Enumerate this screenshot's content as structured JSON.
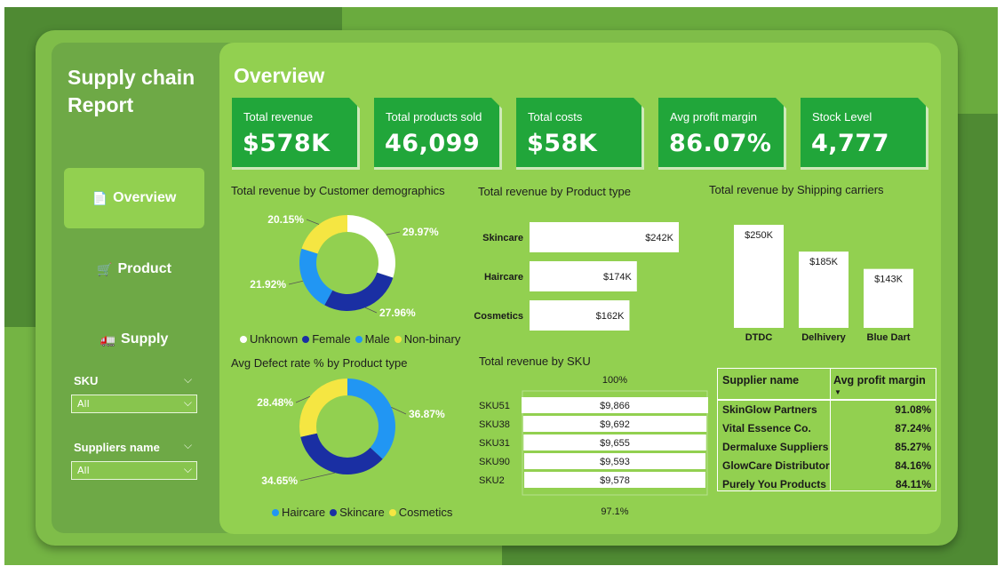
{
  "sidebar": {
    "title_line1": "Supply chain",
    "title_line2": "Report",
    "nav": [
      {
        "label": "Overview",
        "icon": "📄",
        "icon_name": "document-icon",
        "active": true
      },
      {
        "label": "Product",
        "icon": "🛒",
        "icon_name": "cart-icon",
        "active": false
      },
      {
        "label": "Supply",
        "icon": "🚛",
        "icon_name": "truck-icon",
        "active": false
      }
    ],
    "filters": [
      {
        "label": "SKU",
        "value": "All"
      },
      {
        "label": "Suppliers name",
        "value": "All"
      }
    ]
  },
  "main": {
    "title": "Overview"
  },
  "kpis": [
    {
      "label": "Total revenue",
      "value": "$578K"
    },
    {
      "label": "Total products sold",
      "value": "46,099"
    },
    {
      "label": "Total costs",
      "value": "$58K"
    },
    {
      "label": "Avg profit margin",
      "value": "86.07%"
    },
    {
      "label": "Stock Level",
      "value": "4,777"
    }
  ],
  "colors": {
    "white": "#ffffff",
    "navy": "#1a2fa3",
    "blue": "#2196f3",
    "yellow": "#f5e642",
    "kpi_green": "#21a63a",
    "panel_green": "#92d050"
  },
  "chart_data": [
    {
      "type": "pie",
      "title": "Total revenue by Customer demographics",
      "categories": [
        "Unknown",
        "Female",
        "Male",
        "Non-binary"
      ],
      "values": [
        29.97,
        27.96,
        21.92,
        20.15
      ],
      "value_labels": [
        "29.97%",
        "27.96%",
        "21.92%",
        "20.15%"
      ],
      "colors": [
        "#ffffff",
        "#1a2fa3",
        "#2196f3",
        "#f5e642"
      ],
      "legend": "bottom"
    },
    {
      "type": "pie",
      "title": "Avg Defect rate % by Product type",
      "categories": [
        "Haircare",
        "Skincare",
        "Cosmetics"
      ],
      "values": [
        36.87,
        34.65,
        28.48
      ],
      "value_labels": [
        "36.87%",
        "34.65%",
        "28.48%"
      ],
      "colors": [
        "#2196f3",
        "#1a2fa3",
        "#f5e642"
      ],
      "legend": "bottom"
    },
    {
      "type": "bar",
      "orientation": "horizontal",
      "title": "Total revenue by Product type",
      "categories": [
        "Skincare",
        "Haircare",
        "Cosmetics"
      ],
      "values": [
        242,
        174,
        162
      ],
      "value_labels": [
        "$242K",
        "$174K",
        "$162K"
      ],
      "unit": "K$"
    },
    {
      "type": "bar",
      "orientation": "vertical",
      "title": "Total revenue by Shipping carriers",
      "categories": [
        "DTDC",
        "Delhivery",
        "Blue Dart"
      ],
      "values": [
        250,
        185,
        143
      ],
      "value_labels": [
        "$250K",
        "$185K",
        "$143K"
      ],
      "unit": "K$"
    },
    {
      "type": "bar",
      "orientation": "funnel",
      "title": "Total revenue by SKU",
      "categories": [
        "SKU51",
        "SKU38",
        "SKU31",
        "SKU90",
        "SKU2"
      ],
      "values": [
        9866,
        9692,
        9655,
        9593,
        9578
      ],
      "value_labels": [
        "$9,866",
        "$9,692",
        "$9,655",
        "$9,593",
        "$9,578"
      ],
      "top_label": "100%",
      "bottom_label": "97.1%"
    }
  ],
  "supplier_table": {
    "headers": [
      "Supplier name",
      "Avg profit margin"
    ],
    "rows": [
      [
        "SkinGlow Partners",
        "91.08%"
      ],
      [
        "Vital Essence Co.",
        "87.24%"
      ],
      [
        "Dermaluxe Suppliers",
        "85.27%"
      ],
      [
        "GlowCare Distributor",
        "84.16%"
      ],
      [
        "Purely You Products",
        "84.11%"
      ]
    ]
  }
}
